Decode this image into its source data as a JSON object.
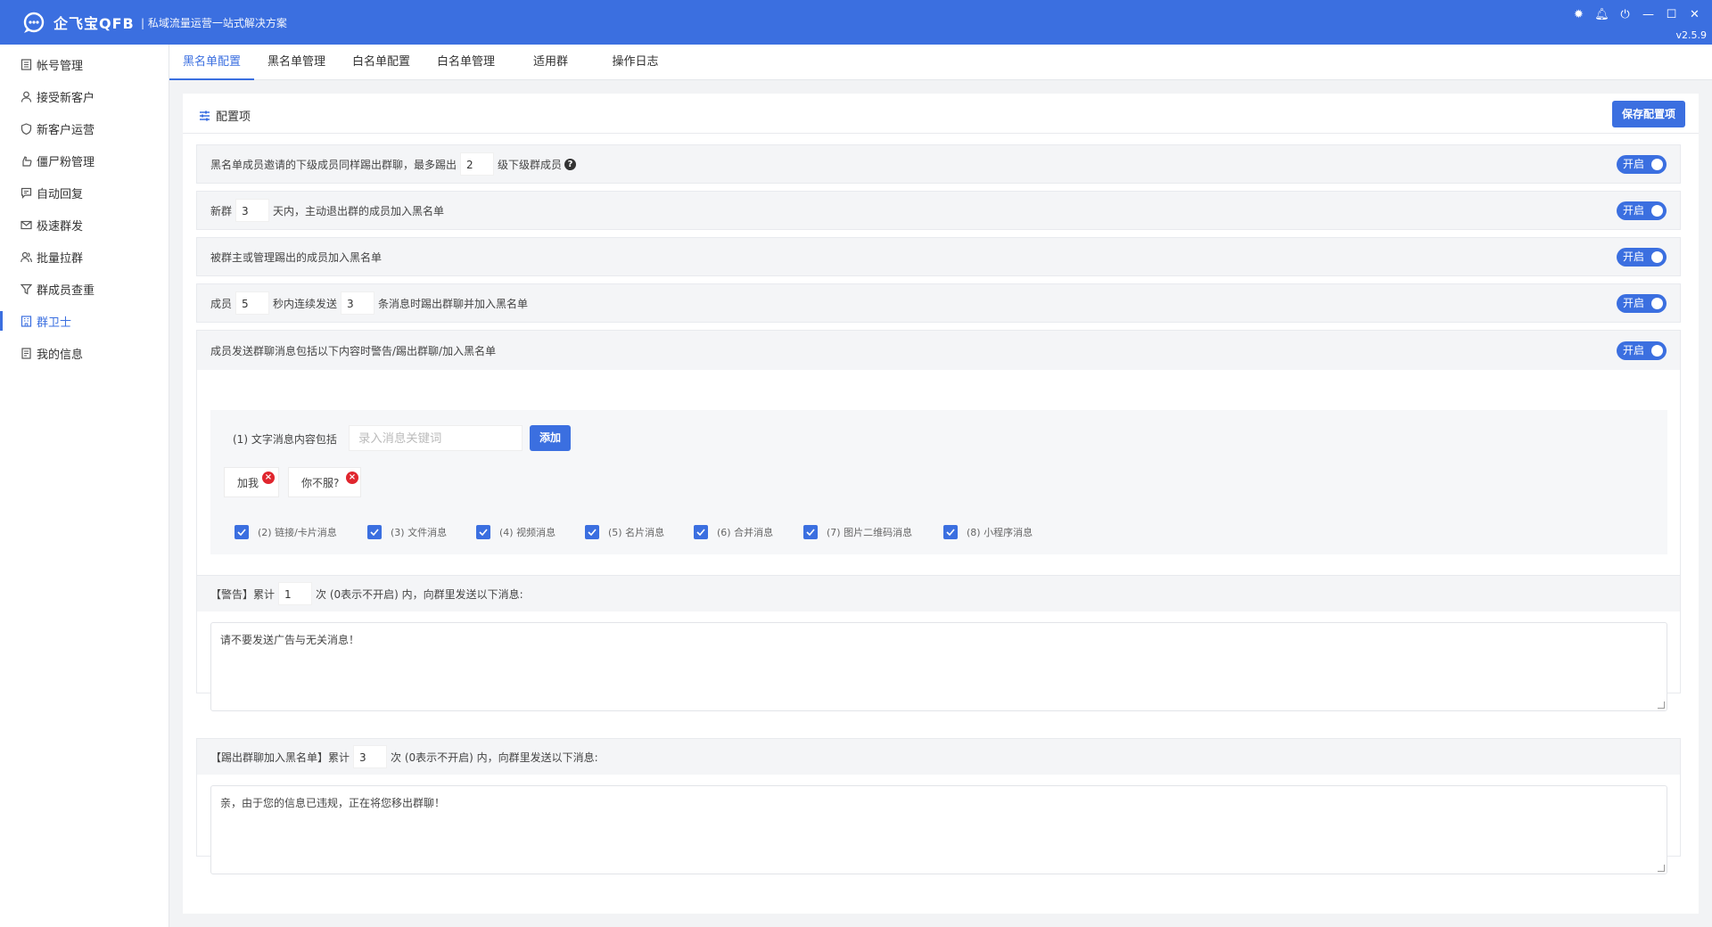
{
  "app": {
    "brand": "企飞宝QFB",
    "slogan": "| 私域流量运营一站式解决方案",
    "version": "v2.5.9",
    "accent_color": "#3b6fe0",
    "window_controls": [
      "bug-icon",
      "bell-icon",
      "power-icon",
      "minimize-icon",
      "maximize-icon",
      "close-icon"
    ]
  },
  "sidebar": {
    "items": [
      {
        "label": "帐号管理",
        "icon": "account-icon",
        "active": false
      },
      {
        "label": "接受新客户",
        "icon": "user-icon",
        "active": false
      },
      {
        "label": "新客户运营",
        "icon": "shield-icon",
        "active": false
      },
      {
        "label": "僵尸粉管理",
        "icon": "hand-icon",
        "active": false
      },
      {
        "label": "自动回复",
        "icon": "chat-icon",
        "active": false
      },
      {
        "label": "极速群发",
        "icon": "mail-icon",
        "active": false
      },
      {
        "label": "批量拉群",
        "icon": "users-icon",
        "active": false
      },
      {
        "label": "群成员查重",
        "icon": "filter-icon",
        "active": false
      },
      {
        "label": "群卫士",
        "icon": "building-icon",
        "active": true
      },
      {
        "label": "我的信息",
        "icon": "document-icon",
        "active": false
      }
    ]
  },
  "tabs": [
    {
      "label": "黑名单配置",
      "active": true
    },
    {
      "label": "黑名单管理",
      "active": false
    },
    {
      "label": "白名单配置",
      "active": false
    },
    {
      "label": "白名单管理",
      "active": false
    },
    {
      "label": "适用群",
      "active": false
    },
    {
      "label": "操作日志",
      "active": false
    }
  ],
  "panel": {
    "title": "配置项",
    "save_label": "保存配置项"
  },
  "rules": {
    "r1": {
      "prefix": "黑名单成员邀请的下级成员同样踢出群聊，最多踢出",
      "value": "2",
      "suffix": "级下级群成员",
      "help": "?",
      "toggle": "开启"
    },
    "r2": {
      "prefix": "新群",
      "value": "3",
      "suffix": "天内，主动退出群的成员加入黑名单",
      "toggle": "开启"
    },
    "r3": {
      "text": "被群主或管理踢出的成员加入黑名单",
      "toggle": "开启"
    },
    "r4": {
      "prefix": "成员",
      "value1": "5",
      "middle": "秒内连续发送",
      "value2": "3",
      "suffix": "条消息时踢出群聊并加入黑名单",
      "toggle": "开启"
    },
    "r5": {
      "text": "成员发送群聊消息包括以下内容时警告/踢出群聊/加入黑名单",
      "toggle": "开启"
    }
  },
  "keywords": {
    "label": "(1) 文字消息内容包括",
    "placeholder": "录入消息关键词",
    "add_label": "添加",
    "tags": [
      "加我",
      "你不服?"
    ],
    "remove_glyph": "×"
  },
  "msg_types": [
    {
      "label": "(2) 链接/卡片消息",
      "checked": true
    },
    {
      "label": "(3) 文件消息",
      "checked": true
    },
    {
      "label": "(4) 视频消息",
      "checked": true
    },
    {
      "label": "(5) 名片消息",
      "checked": true
    },
    {
      "label": "(6) 合并消息",
      "checked": true
    },
    {
      "label": "(7) 图片二维码消息",
      "checked": true
    },
    {
      "label": "(8) 小程序消息",
      "checked": true
    }
  ],
  "warning": {
    "prefix": "【警告】累计",
    "count": "1",
    "suffix": "次 (0表示不开启) 内，向群里发送以下消息:",
    "message": "请不要发送广告与无关消息！"
  },
  "kick": {
    "prefix": "【踢出群聊加入黑名单】累计",
    "count": "3",
    "suffix": "次 (0表示不开启) 内，向群里发送以下消息:",
    "message": "亲，由于您的信息已违规，正在将您移出群聊！"
  }
}
